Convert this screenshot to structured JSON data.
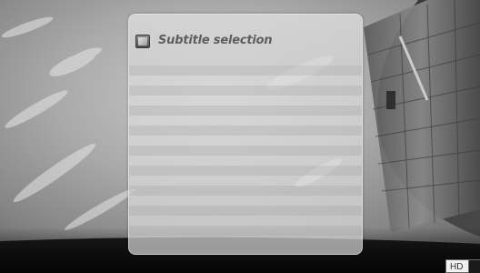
{
  "dialog": {
    "title": "Subtitle selection",
    "icon": "subtitle-icon",
    "options": []
  },
  "status": {
    "hd_label": "HD"
  }
}
